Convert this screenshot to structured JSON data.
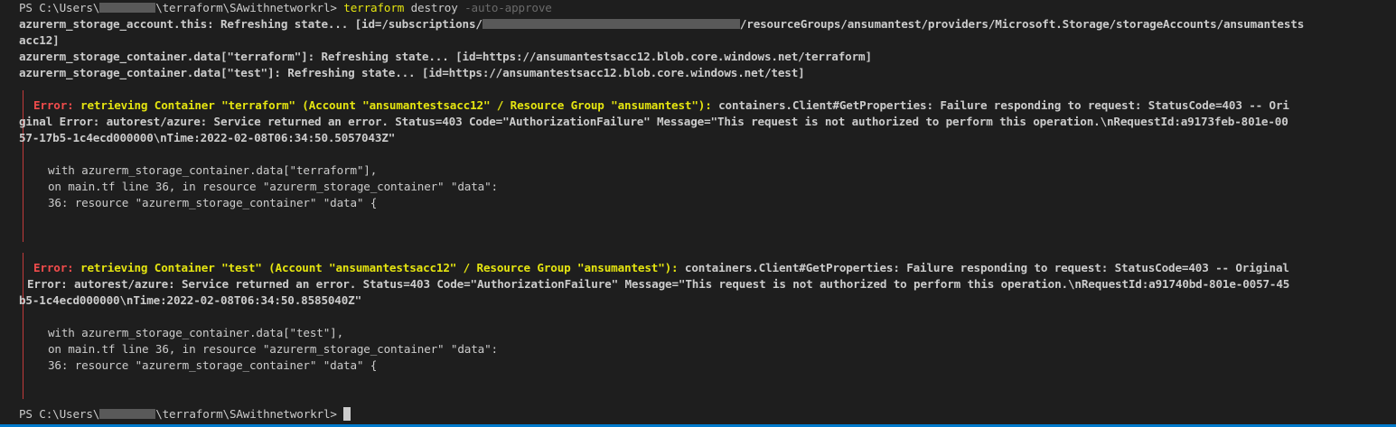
{
  "prompt": {
    "prefix": "PS C:\\Users\\",
    "suffix": "\\terraform\\SAwithnetworkrl>",
    "command": "terraform",
    "args": "destroy",
    "flag": "-auto-approve"
  },
  "refresh": {
    "l1_pre": "azurerm_storage_account.this: Refreshing state... [id=/subscriptions/",
    "l1_post": "/resourceGroups/ansumantest/providers/Microsoft.Storage/storageAccounts/ansumantests",
    "l1_wrap": "acc12]",
    "l2": "azurerm_storage_container.data[\"terraform\"]: Refreshing state... [id=https://ansumantestsacc12.blob.core.windows.net/terraform]",
    "l3": "azurerm_storage_container.data[\"test\"]: Refreshing state... [id=https://ansumantestsacc12.blob.core.windows.net/test]"
  },
  "errors": [
    {
      "label": "Error:",
      "summary": "retrieving Container \"terraform\" (Account \"ansumantestsacc12\" / Resource Group \"ansumantest\"):",
      "detail_1": " containers.Client#GetProperties: Failure responding to request: StatusCode=403 -- Ori",
      "detail_2": "ginal Error: autorest/azure: Service returned an error. Status=403 Code=\"AuthorizationFailure\" Message=\"This request is not authorized to perform this operation.\\nRequestId:a9173feb-801e-00",
      "detail_3": "57-17b5-1c4ecd000000\\nTime:2022-02-08T06:34:50.5057043Z\"",
      "with": "with azurerm_storage_container.data[\"terraform\"],",
      "on": "on main.tf line 36, in resource \"azurerm_storage_container\" \"data\":",
      "src": "36: resource \"azurerm_storage_container\" \"data\" {"
    },
    {
      "label": "Error:",
      "summary": "retrieving Container \"test\" (Account \"ansumantestsacc12\" / Resource Group \"ansumantest\"):",
      "detail_1": " containers.Client#GetProperties: Failure responding to request: StatusCode=403 -- Original",
      "detail_2": "Error: autorest/azure: Service returned an error. Status=403 Code=\"AuthorizationFailure\" Message=\"This request is not authorized to perform this operation.\\nRequestId:a91740bd-801e-0057-45",
      "detail_3": "b5-1c4ecd000000\\nTime:2022-02-08T06:34:50.8585040Z\"",
      "with": "with azurerm_storage_container.data[\"test\"],",
      "on": "on main.tf line 36, in resource \"azurerm_storage_container\" \"data\":",
      "src": "36: resource \"azurerm_storage_container\" \"data\" {"
    }
  ],
  "colors": {
    "background": "#1e1e1e",
    "text": "#cccccc",
    "error_label": "#f14c4c",
    "error_summary": "#e5e510",
    "gutter": "#c13b3b",
    "status_bar": "#007acc"
  }
}
